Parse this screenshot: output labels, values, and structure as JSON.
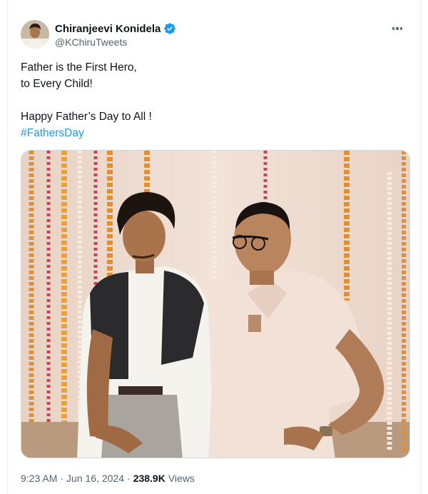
{
  "author": {
    "display_name": "Chiranjeevi Konidela",
    "handle": "@KChiruTweets",
    "verified": true,
    "verified_color": "#1d9bf0"
  },
  "tweet": {
    "lines": [
      "Father is the First Hero,",
      "to Every Child!",
      "",
      "Happy Father’s Day to All !"
    ],
    "hashtag": "#FathersDay",
    "hashtag_color": "#1d9bf0"
  },
  "meta": {
    "time": "9:23 AM",
    "separator": "·",
    "date": "Jun 16, 2024",
    "separator2": "·",
    "views_count": "238.9K",
    "views_label": "Views"
  },
  "icons": {
    "more": "more-icon",
    "verified": "verified-badge-icon"
  }
}
